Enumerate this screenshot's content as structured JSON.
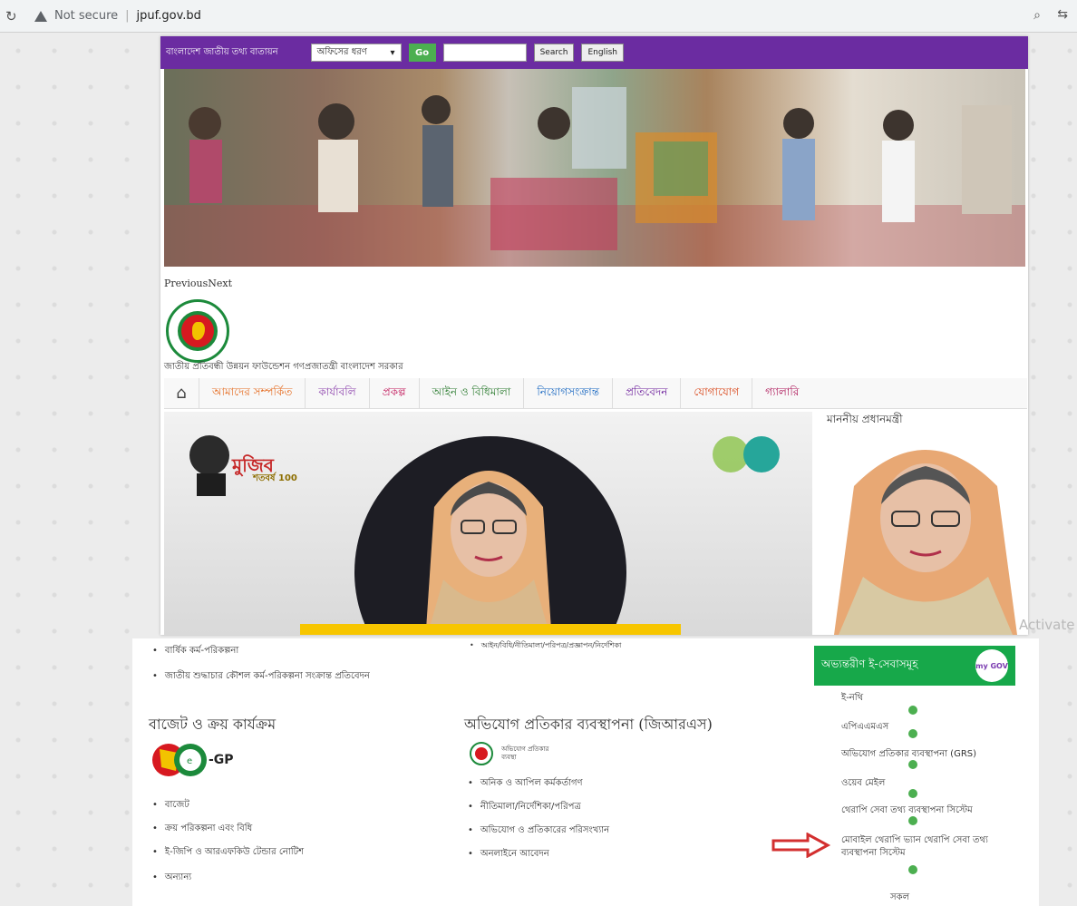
{
  "browser": {
    "security_label": "Not secure",
    "url": "jpuf.gov.bd"
  },
  "topbar": {
    "site_name": "বাংলাদেশ জাতীয় তথ্য বাতায়ন",
    "office_select": "অফিসের ধরণ",
    "go_label": "Go",
    "search_placeholder": "",
    "search_label": "Search",
    "english_label": "English"
  },
  "slider": {
    "prev_next": "PreviousNext"
  },
  "org": {
    "name": "জাতীয় প্রতিবন্ধী উন্নয়ন ফাউন্ডেশন গণপ্রজাতন্ত্রী বাংলাদেশ সরকার"
  },
  "nav": {
    "items": [
      "আমাদের সম্পর্কিত",
      "কার্যাবলি",
      "প্রকল্প",
      "আইন ও বিধিমালা",
      "নিয়োগসংক্রান্ত",
      "প্রতিবেদন",
      "যোগাযোগ",
      "গ্যালারি"
    ]
  },
  "hero": {
    "mujib_text": "মুজিব",
    "mujib_100": "শতবর্ষ 100"
  },
  "sidebar": {
    "pm_title": "মাননীয় প্রধানমন্ত্রী"
  },
  "lower": {
    "top_bullets": [
      "বার্ষিক কর্ম-পরিকল্পনা",
      "জাতীয় শুদ্ধাচার কৌশল কর্ম-পরিকল্পনা সংক্রান্ত প্রতিবেদন"
    ],
    "top_bullet_right": "আইন/বিধি/নীতিমালা/পরিপত্র/প্রজ্ঞাপন/নির্দেশিকা",
    "budget_title": "বাজেট ও ক্রয় কার্যক্রম",
    "egp_label": "-GP",
    "budget_items": [
      "বাজেট",
      "ক্রয় পরিকল্পনা এবং বিধি",
      "ই-জিপি ও আরএফকিউ টেন্ডার নোটিশ",
      "অন্যান্য"
    ],
    "grs_title": "অভিযোগ প্রতিকার ব্যবস্থাপনা (জিআরএস)",
    "grs_logo_text": "অভিযোগ প্রতিকার ব্যবস্থা",
    "grs_items": [
      "অনিক ও আপিল কর্মকর্তাগণ",
      "নীতিমালা/নির্দেশিকা/পরিপত্র",
      "অভিযোগ ও প্রতিকারের পরিসংখ্যান",
      "অনলাইনে আবেদন"
    ],
    "eservice_title": "অভ্যন্তরীণ ই-সেবাসমূহ",
    "mygov": "my GOV",
    "eservices": [
      "ই-নথি",
      "এপিএএমএস",
      "অভিযোগ প্রতিকার ব্যবস্থাপনা (GRS)",
      "ওয়েব মেইল",
      "থেরাপি সেবা তথ্য ব্যবস্থাপনা সিস্টেম",
      "মোবাইল থেরাপি ভ্যান থেরাপি সেবা তথ্য ব্যবস্থাপনা সিস্টেম"
    ],
    "all_label": "সকল"
  },
  "overlay": {
    "activate": "Activate"
  }
}
